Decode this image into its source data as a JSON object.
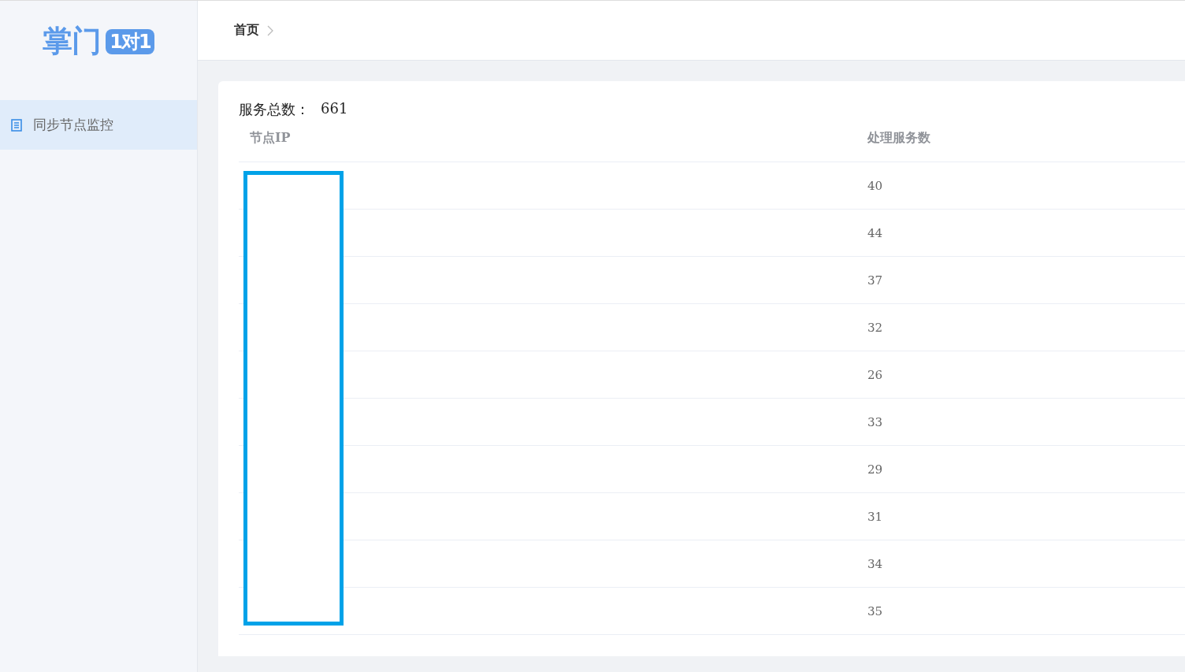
{
  "logo": {
    "text": "掌门",
    "badge": "1对1"
  },
  "sidebar": {
    "items": [
      {
        "label": "同步节点监控",
        "selected": true
      }
    ]
  },
  "breadcrumb": [
    "首页"
  ],
  "summary": {
    "label": "服务总数：",
    "value": "661"
  },
  "table": {
    "columns": [
      "节点IP",
      "处理服务数"
    ],
    "rows": [
      {
        "count": "40"
      },
      {
        "count": "44"
      },
      {
        "count": "37"
      },
      {
        "count": "32"
      },
      {
        "count": "26"
      },
      {
        "count": "33"
      },
      {
        "count": "29"
      },
      {
        "count": "31"
      },
      {
        "count": "34"
      },
      {
        "count": "35"
      }
    ],
    "ip_redacted": true
  }
}
